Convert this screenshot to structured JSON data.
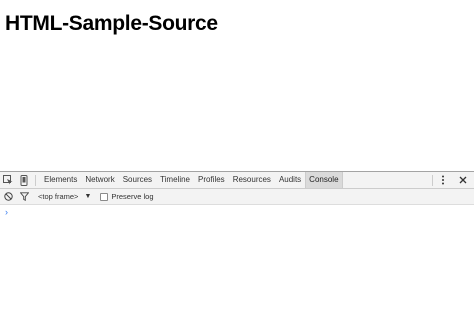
{
  "page": {
    "heading": "HTML-Sample-Source"
  },
  "devtools": {
    "tabs": [
      {
        "label": "Elements"
      },
      {
        "label": "Network"
      },
      {
        "label": "Sources"
      },
      {
        "label": "Timeline"
      },
      {
        "label": "Profiles"
      },
      {
        "label": "Resources"
      },
      {
        "label": "Audits"
      },
      {
        "label": "Console"
      }
    ],
    "selected_tab": "Console",
    "console": {
      "context": "<top frame>",
      "context_arrow": "▼",
      "preserve_log_label": "Preserve log",
      "preserve_log_checked": false,
      "prompt_symbol": "›"
    },
    "icons": {
      "inspect": "inspect-element-icon",
      "device": "device-mode-icon",
      "more": "more-vertical-icon",
      "close": "close-icon",
      "clear": "clear-console-icon",
      "filter": "filter-icon"
    },
    "colors": {
      "toolbar_bg": "#f3f3f3",
      "selected_tab_bg": "#dadada",
      "prompt": "#367cf1"
    }
  }
}
